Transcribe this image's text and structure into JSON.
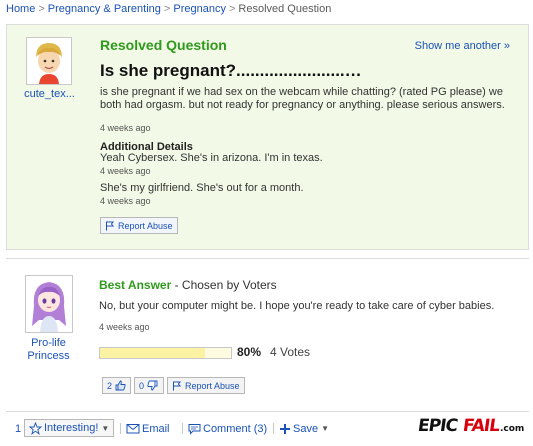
{
  "breadcrumb": {
    "home": "Home",
    "category": "Pregnancy & Parenting",
    "subcategory": "Pregnancy",
    "current": "Resolved Question",
    "separator": ">"
  },
  "question": {
    "status": "Resolved Question",
    "show_more": "Show me another »",
    "title": "Is she pregnant?.......................…",
    "body": "is she pregnant if we had sex on the webcam while chatting? (rated PG please) we both had orgasm. but not ready for pregnancy or anything. please serious answers.",
    "asked_ago": "4 weeks ago",
    "asker": "cute_tex...",
    "additional_details_heading": "Additional Details",
    "details": [
      {
        "text": "Yeah Cybersex. She's in arizona. I'm in texas.",
        "ago": "4 weeks ago"
      },
      {
        "text": "She's my girlfriend. She's out for a month.",
        "ago": "4 weeks ago"
      }
    ],
    "report_label": "Report Abuse"
  },
  "answer": {
    "heading": "Best Answer",
    "chosen_by": " - Chosen by Voters",
    "text": "No, but your computer might be. I hope you're ready to take care of cyber babies.",
    "ago": "4 weeks ago",
    "answerer_line1": "Pro-life",
    "answerer_line2": "Princess",
    "vote_percent_value": 0.8,
    "vote_percent": "80%",
    "vote_count": "4 Votes",
    "thumbs_up": "2",
    "thumbs_down": "0",
    "report_label": "Report Abuse"
  },
  "bottom_bar": {
    "interesting_count": "1",
    "interesting_label": "Interesting!",
    "email_label": "Email",
    "comment_label": "Comment (3)",
    "save_label": "Save"
  },
  "watermark": {
    "epic": "EPIC",
    "fail": "FAIL",
    "dotcom": ".com"
  },
  "colors": {
    "link": "#1a52b8",
    "resolved_green": "#2f9a1c",
    "question_bg": "#f2f9e7",
    "vote_bar": "#fbf2a3",
    "watermark_red": "#d8000c"
  },
  "icons": [
    "star-icon",
    "mail-icon",
    "comment-icon",
    "plus-icon",
    "flag-icon",
    "thumbs-up-icon",
    "thumbs-down-icon"
  ]
}
